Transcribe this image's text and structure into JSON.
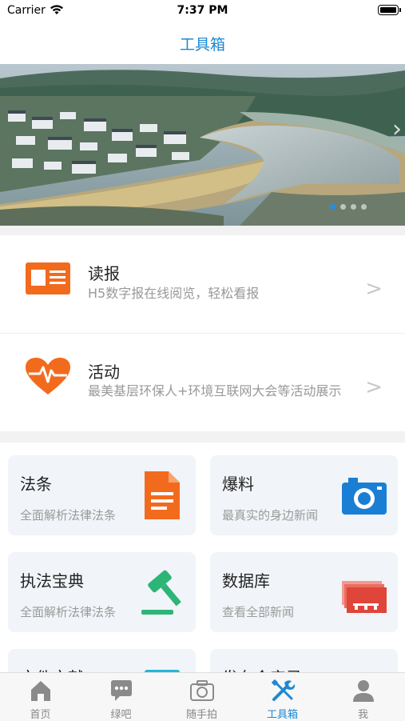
{
  "status": {
    "carrier": "Carrier",
    "time": "7:37 PM"
  },
  "nav": {
    "title": "工具箱"
  },
  "banner": {
    "image": "aerial-river-village-photo",
    "dots": 4,
    "active_dot": 1
  },
  "rows": [
    {
      "title": "读报",
      "subtitle": "H5数字报在线阅览，轻松看报",
      "icon": "newspaper-icon",
      "arrow": ">"
    },
    {
      "title": "活动",
      "subtitle": "最美基层环保人+环境互联网大会等活动展示",
      "icon": "heart-pulse-icon",
      "arrow": ">"
    }
  ],
  "cards": [
    {
      "title": "法条",
      "subtitle": "全面解析法律法条",
      "icon": "document-icon"
    },
    {
      "title": "爆料",
      "subtitle": "最真实的身边新闻",
      "icon": "camera-icon"
    },
    {
      "title": "执法宝典",
      "subtitle": "全面解析法律法条",
      "icon": "gavel-icon"
    },
    {
      "title": "数据库",
      "subtitle": "查看全部新闻",
      "icon": "database-icon"
    },
    {
      "title": "文件文献",
      "subtitle": "",
      "icon": "file-icon"
    },
    {
      "title": "发布会实录",
      "subtitle": "",
      "icon": "record-icon"
    }
  ],
  "tabs": [
    {
      "label": "首页",
      "icon": "home-icon"
    },
    {
      "label": "绿吧",
      "icon": "chat-icon"
    },
    {
      "label": "随手拍",
      "icon": "camera-icon"
    },
    {
      "label": "工具箱",
      "icon": "tools-icon",
      "active": true
    },
    {
      "label": "我",
      "icon": "user-icon"
    }
  ],
  "colors": {
    "accent": "#1e88d3",
    "orange": "#f26b1d",
    "blue": "#1a7fd4",
    "green": "#2db578",
    "red": "#e0453a"
  }
}
